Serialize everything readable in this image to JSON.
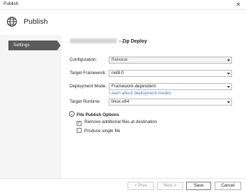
{
  "window": {
    "title": "Publish",
    "close_glyph": "✕"
  },
  "header": {
    "icon": "globe-icon",
    "title": "Publish"
  },
  "sidebar": {
    "items": [
      {
        "label": "Settings",
        "selected": true
      }
    ]
  },
  "main": {
    "title_suffix": "- Zip Deploy",
    "fields": {
      "configuration": {
        "label": "Configuration:",
        "value": "Release"
      },
      "target_framework": {
        "label": "Target Framework:",
        "value": "net8.0"
      },
      "deployment_mode": {
        "label": "Deployment Mode:",
        "value": "Framework-dependent"
      },
      "learn_link": "Learn about deployment modes",
      "target_runtime": {
        "label": "Target Runtime:",
        "value": "linux-x64"
      }
    },
    "file_publish": {
      "title": "File Publish Options",
      "remove_files": {
        "label": "Remove additional files at destination",
        "checked": true,
        "mark": "✓"
      },
      "single_file": {
        "label": "Produce single file",
        "checked": false
      }
    }
  },
  "footer": {
    "prev": "< Prev",
    "next": "Next >",
    "save": "Save",
    "cancel": "Cancel"
  }
}
